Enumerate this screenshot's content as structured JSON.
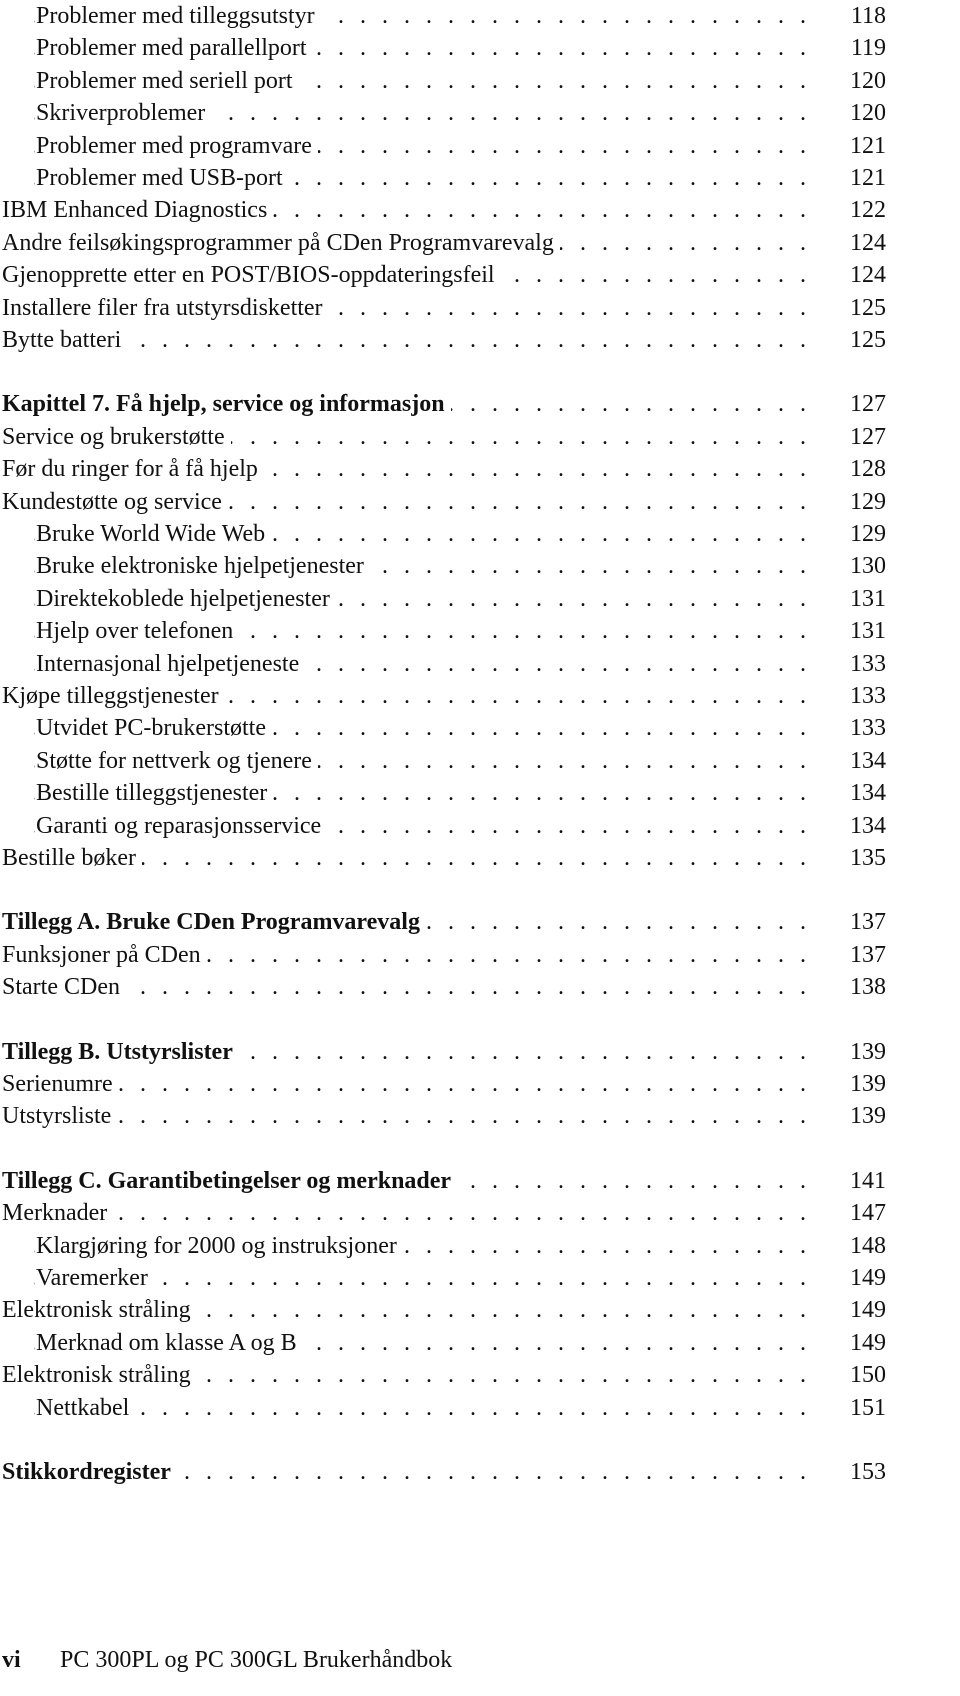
{
  "toc": [
    {
      "label": "Problemer med tilleggsutstyr",
      "page": "118",
      "level": 1,
      "bold": false,
      "top": 0
    },
    {
      "label": "Problemer med parallellport",
      "page": "119",
      "level": 1,
      "bold": false
    },
    {
      "label": "Problemer med seriell port",
      "page": "120",
      "level": 1,
      "bold": false
    },
    {
      "label": "Skriverproblemer",
      "page": "120",
      "level": 1,
      "bold": false
    },
    {
      "label": "Problemer med programvare",
      "page": "121",
      "level": 1,
      "bold": false
    },
    {
      "label": "Problemer med USB-port",
      "page": "121",
      "level": 1,
      "bold": false
    },
    {
      "label": "IBM Enhanced Diagnostics",
      "page": "122",
      "level": 0,
      "bold": false
    },
    {
      "label": "Andre feilsøkingsprogrammer på CDen Programvarevalg",
      "page": "124",
      "level": 0,
      "bold": false
    },
    {
      "label": "Gjenopprette etter en POST/BIOS-oppdateringsfeil",
      "page": "124",
      "level": 0,
      "bold": false
    },
    {
      "label": "Installere filer fra utstyrsdisketter",
      "page": "125",
      "level": 0,
      "bold": false
    },
    {
      "label": "Bytte batteri",
      "page": "125",
      "level": 0,
      "bold": false
    },
    {
      "label": "Kapittel 7.  Få hjelp, service og informasjon",
      "page": "127",
      "level": 0,
      "bold": true,
      "gap": true
    },
    {
      "label": "Service og brukerstøtte",
      "page": "127",
      "level": 0,
      "bold": false
    },
    {
      "label": "Før du ringer for å få hjelp",
      "page": "128",
      "level": 0,
      "bold": false
    },
    {
      "label": "Kundestøtte og service",
      "page": "129",
      "level": 0,
      "bold": false
    },
    {
      "label": "Bruke World Wide Web",
      "page": "129",
      "level": 1,
      "bold": false
    },
    {
      "label": "Bruke elektroniske hjelpetjenester",
      "page": "130",
      "level": 1,
      "bold": false
    },
    {
      "label": "Direktekoblede hjelpetjenester",
      "page": "131",
      "level": 1,
      "bold": false
    },
    {
      "label": "Hjelp over telefonen",
      "page": "131",
      "level": 1,
      "bold": false
    },
    {
      "label": "Internasjonal hjelpetjeneste",
      "page": "133",
      "level": 1,
      "bold": false
    },
    {
      "label": "Kjøpe tilleggstjenester",
      "page": "133",
      "level": 0,
      "bold": false
    },
    {
      "label": "Utvidet PC-brukerstøtte",
      "page": "133",
      "level": 1,
      "bold": false
    },
    {
      "label": "Støtte for nettverk og tjenere",
      "page": "134",
      "level": 1,
      "bold": false
    },
    {
      "label": "Bestille tilleggstjenester",
      "page": "134",
      "level": 1,
      "bold": false
    },
    {
      "label": "Garanti og reparasjonsservice",
      "page": "134",
      "level": 1,
      "bold": false
    },
    {
      "label": "Bestille bøker",
      "page": "135",
      "level": 0,
      "bold": false
    },
    {
      "label": "Tillegg A.  Bruke CDen Programvarevalg",
      "page": "137",
      "level": 0,
      "bold": true,
      "gap": true
    },
    {
      "label": "Funksjoner på CDen",
      "page": "137",
      "level": 0,
      "bold": false
    },
    {
      "label": "Starte CDen",
      "page": "138",
      "level": 0,
      "bold": false
    },
    {
      "label": "Tillegg B.  Utstyrslister",
      "page": "139",
      "level": 0,
      "bold": true,
      "gap": true
    },
    {
      "label": "Serienumre",
      "page": "139",
      "level": 0,
      "bold": false
    },
    {
      "label": "Utstyrsliste",
      "page": "139",
      "level": 0,
      "bold": false
    },
    {
      "label": "Tillegg C.  Garantibetingelser og merknader",
      "page": "141",
      "level": 0,
      "bold": true,
      "gap": true
    },
    {
      "label": "Merknader",
      "page": "147",
      "level": 0,
      "bold": false
    },
    {
      "label": "Klargjøring for 2000 og instruksjoner",
      "page": "148",
      "level": 1,
      "bold": false
    },
    {
      "label": "Varemerker",
      "page": "149",
      "level": 1,
      "bold": false
    },
    {
      "label": "Elektronisk stråling",
      "page": "149",
      "level": 0,
      "bold": false
    },
    {
      "label": "Merknad om klasse A og B",
      "page": "149",
      "level": 1,
      "bold": false
    },
    {
      "label": "Elektronisk stråling",
      "page": "150",
      "level": 0,
      "bold": false
    },
    {
      "label": "Nettkabel",
      "page": "151",
      "level": 1,
      "bold": false
    },
    {
      "label": "Stikkordregister",
      "page": "153",
      "level": 0,
      "bold": true,
      "gap": true
    }
  ],
  "footer": {
    "page_number": "vi",
    "book_title": "PC 300PL og PC 300GL Brukerhåndbok"
  }
}
